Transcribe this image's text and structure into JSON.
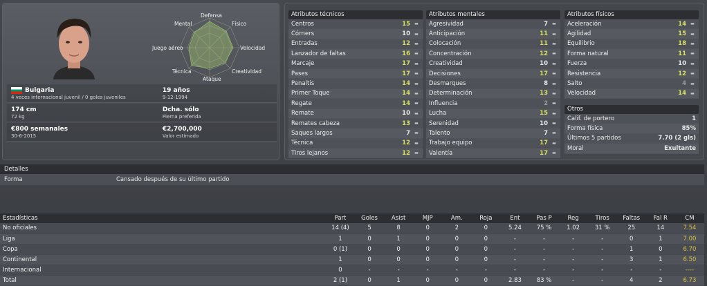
{
  "profile": {
    "radar_labels": {
      "defensa": "Defensa",
      "fisico": "Físico",
      "velocidad": "Velocidad",
      "creatividad": "Creatividad",
      "ataque": "Ataque",
      "tecnica": "Técnica",
      "juego_aereo": "Juego aéreo",
      "mental": "Mental"
    },
    "nationality": "Bulgaria",
    "caps": "4 veces internacional juvenil / 0 goles juveniles",
    "age": "19 años",
    "dob": "9-12-1994",
    "height": "174 cm",
    "weight": "72 kg",
    "foot": "Dcha. sólo",
    "foot_label": "Pierna preferida",
    "wage": "€800 semanales",
    "contract_end": "30-6-2015",
    "value": "€2,700,000",
    "value_label": "Valor estimado"
  },
  "technical": {
    "title": "Atributos técnicos",
    "items": [
      {
        "name": "Centros",
        "val": "15"
      },
      {
        "name": "Córners",
        "val": "10"
      },
      {
        "name": "Entradas",
        "val": "12"
      },
      {
        "name": "Lanzador de faltas",
        "val": "16"
      },
      {
        "name": "Marcaje",
        "val": "17"
      },
      {
        "name": "Pases",
        "val": "17"
      },
      {
        "name": "Penaltis",
        "val": "14"
      },
      {
        "name": "Primer Toque",
        "val": "14"
      },
      {
        "name": "Regate",
        "val": "14"
      },
      {
        "name": "Remate",
        "val": "10"
      },
      {
        "name": "Remates cabeza",
        "val": "13"
      },
      {
        "name": "Saques largos",
        "val": "7"
      },
      {
        "name": "Técnica",
        "val": "12"
      },
      {
        "name": "Tiros lejanos",
        "val": "12"
      }
    ]
  },
  "mental": {
    "title": "Atributos mentales",
    "items": [
      {
        "name": "Agresividad",
        "val": "7"
      },
      {
        "name": "Anticipación",
        "val": "11"
      },
      {
        "name": "Colocación",
        "val": "11"
      },
      {
        "name": "Concentración",
        "val": "12"
      },
      {
        "name": "Creatividad",
        "val": "10"
      },
      {
        "name": "Decisiones",
        "val": "17"
      },
      {
        "name": "Desmarques",
        "val": "8"
      },
      {
        "name": "Determinación",
        "val": "13"
      },
      {
        "name": "Influencia",
        "val": "2"
      },
      {
        "name": "Lucha",
        "val": "15"
      },
      {
        "name": "Serenidad",
        "val": "10"
      },
      {
        "name": "Talento",
        "val": "7"
      },
      {
        "name": "Trabajo equipo",
        "val": "17"
      },
      {
        "name": "Valentía",
        "val": "17"
      }
    ]
  },
  "physical": {
    "title": "Atributos físicos",
    "items": [
      {
        "name": "Aceleración",
        "val": "14"
      },
      {
        "name": "Agilidad",
        "val": "15"
      },
      {
        "name": "Equilibrio",
        "val": "18"
      },
      {
        "name": "Forma natural",
        "val": "11"
      },
      {
        "name": "Fuerza",
        "val": "10"
      },
      {
        "name": "Resistencia",
        "val": "12"
      },
      {
        "name": "Salto",
        "val": "4"
      },
      {
        "name": "Velocidad",
        "val": "14"
      }
    ]
  },
  "otros": {
    "title": "Otros",
    "items": [
      {
        "name": "Calif. de portero",
        "val": "1"
      },
      {
        "name": "Forma física",
        "val": "85%"
      },
      {
        "name": "Últimos 5 partidos",
        "val": "7.70 (2 gls)"
      },
      {
        "name": "Moral",
        "val": "Exultante"
      }
    ]
  },
  "details": {
    "title": "Detalles",
    "label": "Forma",
    "value": "Cansado después de su último partido"
  },
  "stats": {
    "headers": [
      "Estadísticas",
      "Part",
      "Goles",
      "Asist",
      "MJP",
      "Am.",
      "Roja",
      "Ent",
      "Pas P",
      "Reg",
      "Tiros",
      "Faltas",
      "Fal R",
      "CM"
    ],
    "rows": [
      [
        "No oficiales",
        "14 (4)",
        "5",
        "8",
        "0",
        "2",
        "0",
        "5.24",
        "75 %",
        "1.02",
        "31 %",
        "25",
        "14",
        "7.54"
      ],
      [
        "Liga",
        "1",
        "0",
        "1",
        "0",
        "0",
        "0",
        "-",
        "-",
        "-",
        "-",
        "0",
        "1",
        "7.00"
      ],
      [
        "Copa",
        "0 (1)",
        "0",
        "0",
        "0",
        "0",
        "0",
        "-",
        "-",
        "-",
        "-",
        "1",
        "0",
        "6.70"
      ],
      [
        "Continental",
        "1",
        "0",
        "0",
        "0",
        "0",
        "0",
        "-",
        "-",
        "-",
        "-",
        "3",
        "1",
        "6.50"
      ],
      [
        "Internacional",
        "0",
        "-",
        "-",
        "-",
        "-",
        "-",
        "-",
        "-",
        "-",
        "-",
        "-",
        "-",
        "----"
      ],
      [
        "Total",
        "2 (1)",
        "0",
        "1",
        "0",
        "0",
        "0",
        "2.83",
        "83 %",
        "-",
        "-",
        "4",
        "2",
        "6.73"
      ]
    ]
  }
}
